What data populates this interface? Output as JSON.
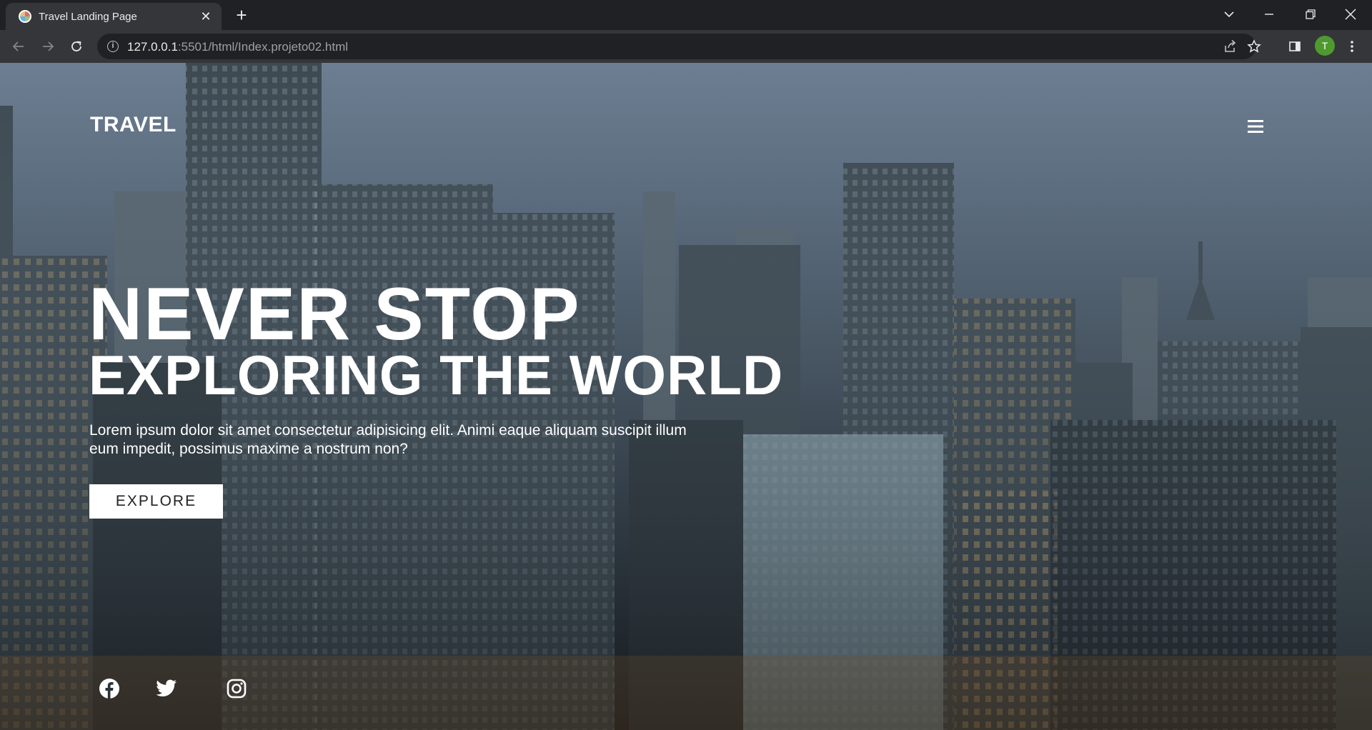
{
  "browser": {
    "tab": {
      "title": "Travel Landing Page",
      "close_glyph": "✕"
    },
    "new_tab_glyph": "+",
    "url_host": "127.0.0.1",
    "url_rest": ":5501/html/Index.projeto02.html",
    "info_glyph": "i",
    "profile_initial": "T",
    "icons": [
      "back-arrow-icon",
      "forward-arrow-icon",
      "reload-icon",
      "share-icon",
      "star-icon",
      "side-panel-icon",
      "kebab-menu-icon",
      "tab-search-icon",
      "minimize-icon",
      "restore-icon",
      "close-icon"
    ]
  },
  "page": {
    "brand": "TRAVEL",
    "menu_icon": "hamburger-icon",
    "hero": {
      "title_line1": "NEVER STOP",
      "title_line2": "EXPLORING THE WORLD",
      "text": "Lorem ipsum dolor sit amet consectetur adipisicing elit. Animi eaque aliquam suscipit illum eum impedit, possimus maxime a nostrum non?",
      "button_label": "EXPLORE"
    },
    "background": "city skyline at dusk",
    "social_icons": [
      "facebook-icon",
      "twitter-icon",
      "instagram-icon"
    ]
  },
  "colors": {
    "chrome_dark": "#202124",
    "chrome_toolbar": "#35363a",
    "avatar": "#4e9a2f",
    "hero_text": "#ffffff",
    "button_bg": "#ffffff"
  }
}
